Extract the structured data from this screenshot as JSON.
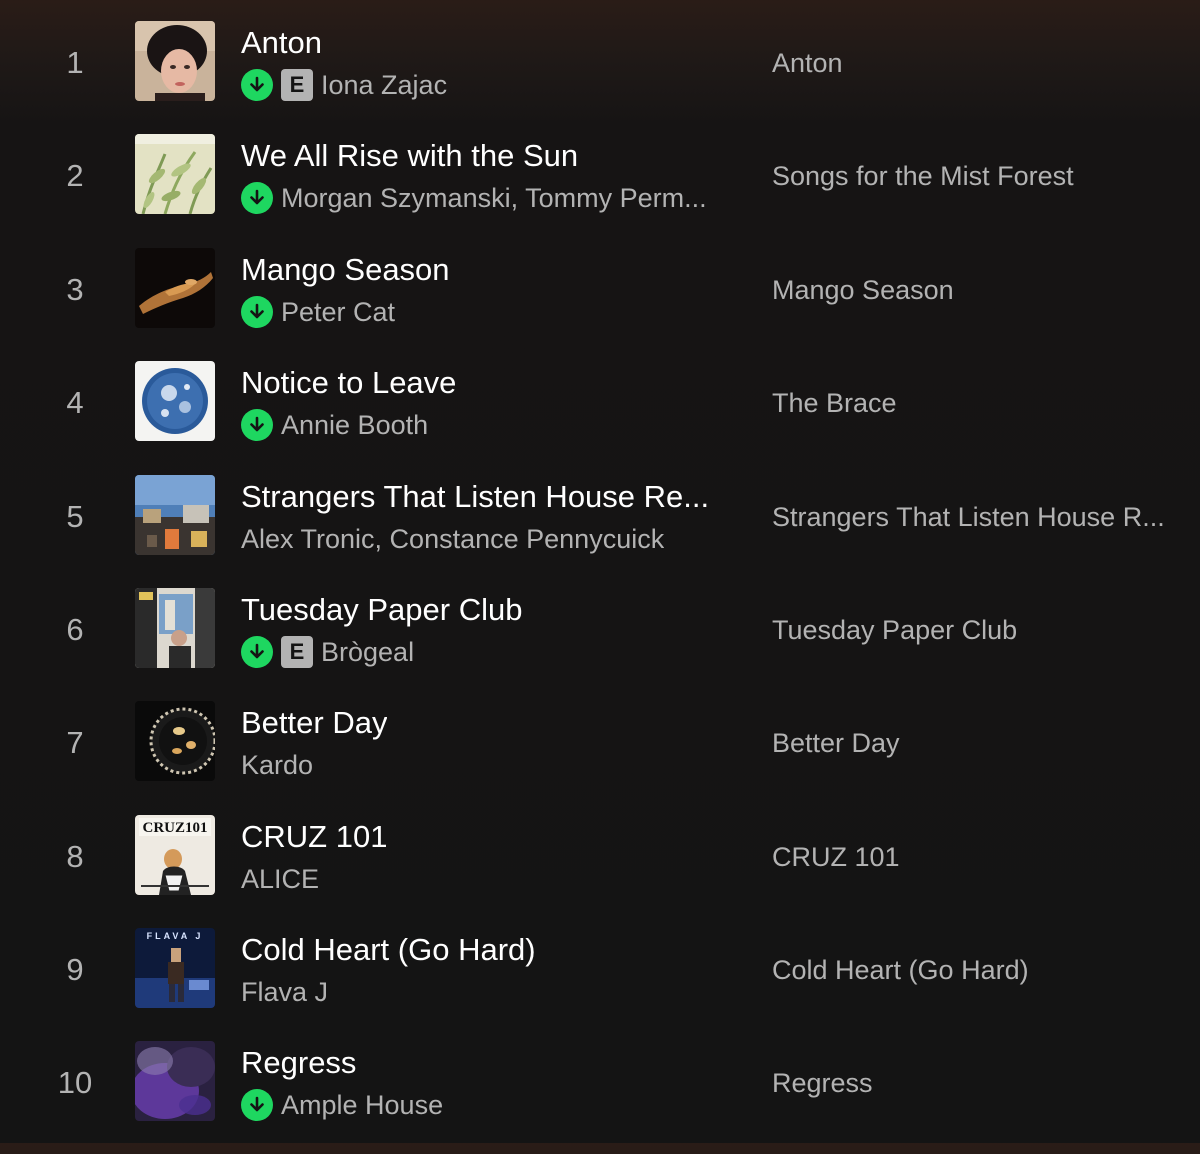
{
  "accent_color": "#1ed760",
  "tracks": [
    {
      "number": "1",
      "title": "Anton",
      "artist": "Iona Zajac",
      "album": "Anton",
      "downloaded": true,
      "explicit": true,
      "explicit_label": "E",
      "cover_icon": "album-art-anton"
    },
    {
      "number": "2",
      "title": "We All Rise with the Sun",
      "artist": "Morgan Szymanski, Tommy Perm...",
      "album": "Songs for the Mist Forest",
      "downloaded": true,
      "explicit": false,
      "cover_icon": "album-art-songs-for-the-mist-forest"
    },
    {
      "number": "3",
      "title": "Mango Season",
      "artist": "Peter Cat",
      "album": "Mango Season",
      "downloaded": true,
      "explicit": false,
      "cover_icon": "album-art-mango-season"
    },
    {
      "number": "4",
      "title": "Notice to Leave",
      "artist": "Annie Booth",
      "album": "The Brace",
      "downloaded": true,
      "explicit": false,
      "cover_icon": "album-art-the-brace"
    },
    {
      "number": "5",
      "title": "Strangers That Listen House Re...",
      "artist": "Alex Tronic, Constance Pennycuick",
      "album": "Strangers That Listen House R...",
      "downloaded": false,
      "explicit": false,
      "cover_icon": "album-art-strangers-that-listen"
    },
    {
      "number": "6",
      "title": "Tuesday Paper Club",
      "artist": "Brògeal",
      "album": "Tuesday Paper Club",
      "downloaded": true,
      "explicit": true,
      "explicit_label": "E",
      "cover_icon": "album-art-tuesday-paper-club"
    },
    {
      "number": "7",
      "title": "Better Day",
      "artist": "Kardo",
      "album": "Better Day",
      "downloaded": false,
      "explicit": false,
      "cover_icon": "album-art-better-day"
    },
    {
      "number": "8",
      "title": "CRUZ 101",
      "artist": "ALICE",
      "album": "CRUZ 101",
      "downloaded": false,
      "explicit": false,
      "cover_icon": "album-art-cruz-101",
      "cover_text": "CRUZ101"
    },
    {
      "number": "9",
      "title": "Cold Heart (Go Hard)",
      "artist": "Flava J",
      "album": "Cold Heart (Go Hard)",
      "downloaded": false,
      "explicit": false,
      "cover_icon": "album-art-cold-heart",
      "cover_text": "FLAVA J"
    },
    {
      "number": "10",
      "title": "Regress",
      "artist": "Ample House",
      "album": "Regress",
      "downloaded": true,
      "explicit": false,
      "cover_icon": "album-art-regress"
    }
  ]
}
